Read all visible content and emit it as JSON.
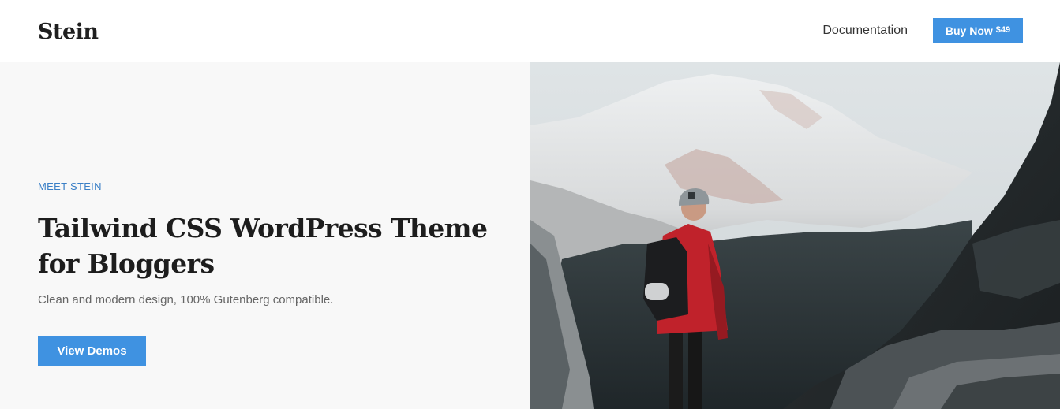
{
  "header": {
    "logo": "Stein",
    "nav": {
      "documentation_label": "Documentation",
      "buy_label": "Buy Now",
      "buy_price": "$49"
    }
  },
  "hero": {
    "eyebrow": "MEET STEIN",
    "title": "Tailwind CSS WordPress Theme for Bloggers",
    "subtitle": "Clean and modern design, 100% Gutenberg compatible.",
    "cta_label": "View Demos"
  },
  "colors": {
    "accent": "#3f92e1",
    "eyebrow": "#3a7fc6",
    "hero_bg": "#f8f8f8"
  },
  "image": {
    "description_icon": "mountain-hiker-photo"
  }
}
